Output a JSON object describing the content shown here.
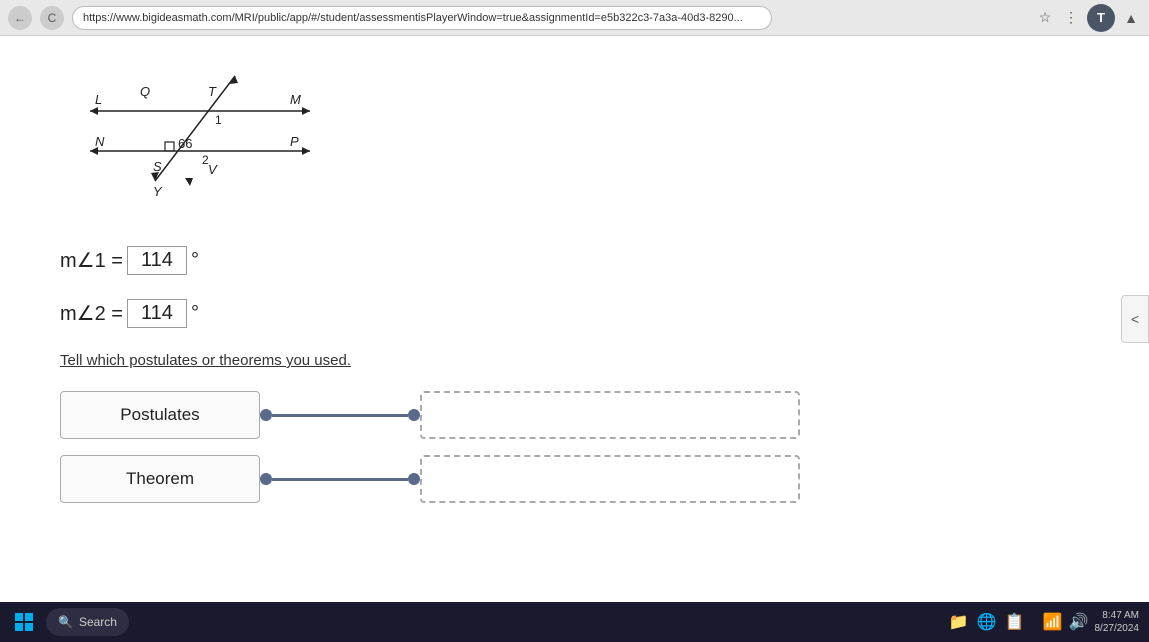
{
  "browser": {
    "url": "https://www.bigideasmath.com/MRI/public/app/#/student/assessmentisPlayerWindow=true&assignmentId=e5b322c3-7a3a-40d3-8290...",
    "nav_back": "←",
    "nav_forward": "→",
    "refresh": "C",
    "star_icon": "☆",
    "user_initial": "T"
  },
  "diagram": {
    "label_L": "L",
    "label_Q": "Q",
    "label_T": "T",
    "label_M": "M",
    "label_N": "N",
    "label_angle_marker": "□",
    "label_66": "66",
    "label_1": "1",
    "label_2": "2",
    "label_P": "P",
    "label_S": "S",
    "label_V": "V",
    "label_Y": "Y"
  },
  "equations": {
    "angle1_label": "m∠1 =",
    "angle1_value": "114",
    "angle2_label": "m∠2 =",
    "angle2_value": "114",
    "degree": "°"
  },
  "prompt": {
    "text": "Tell which postulates or theorems you used."
  },
  "drag_items": [
    {
      "id": "postulates",
      "label": "Postulates"
    },
    {
      "id": "theorem",
      "label": "Theorem"
    }
  ],
  "sidebar": {
    "toggle_icon": "<"
  },
  "taskbar": {
    "search_placeholder": "Search",
    "clock_time": "8:47 AM",
    "clock_date": "8/27/2024"
  }
}
